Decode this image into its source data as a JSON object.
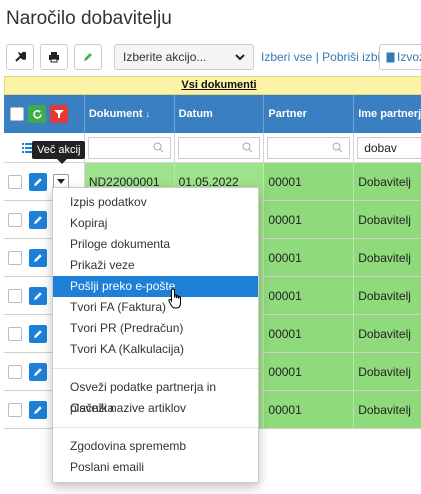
{
  "page": {
    "title": "Naročilo dobavitelju"
  },
  "toolbar": {
    "wrench_icon": "wrench-icon",
    "print_icon": "printer-icon",
    "edit_icon": "pencil-icon",
    "action_select_value": "Izberite akcijo...",
    "select_all_link": "Izberi vse",
    "link_separator": "|",
    "clear_selection_link": "Pobriši izbiro",
    "export_label": "Izvoz"
  },
  "grid": {
    "banner": "Vsi dokumenti",
    "columns": [
      "Dokument",
      "Datum",
      "Partner",
      "Ime partnerja"
    ],
    "filters": {
      "ime_partnerja": "dobav"
    },
    "rows": [
      {
        "dokument": "ND22000001",
        "datum": "01.05.2022",
        "partner": "00001",
        "ime": "Dobavitelj"
      },
      {
        "dokument": "",
        "datum": "",
        "partner": "00001",
        "ime": "Dobavitelj"
      },
      {
        "dokument": "",
        "datum": "",
        "partner": "00001",
        "ime": "Dobavitelj"
      },
      {
        "dokument": "",
        "datum": "",
        "partner": "00001",
        "ime": "Dobavitelj"
      },
      {
        "dokument": "",
        "datum": "",
        "partner": "00001",
        "ime": "Dobavitelj"
      },
      {
        "dokument": "",
        "datum": "",
        "partner": "00001",
        "ime": "Dobavitelj"
      },
      {
        "dokument": "",
        "datum": "",
        "partner": "00001",
        "ime": "Dobavitelj"
      }
    ]
  },
  "tooltip": "Več akcij",
  "menu": {
    "group1": [
      "Izpis podatkov",
      "Kopiraj",
      "Priloge dokumenta",
      "Prikaži veze",
      "Pošlji preko e-pošte",
      "Tvori FA (Faktura)",
      "Tvori PR (Predračun)",
      "Tvori KA (Kalkulacija)"
    ],
    "group2": [
      "Osveži podatke partnerja in plačnika",
      "Osveži nazive artiklov"
    ],
    "group3": [
      "Zgodovina sprememb",
      "Poslani emaili"
    ],
    "highlighted_item": "Pošlji preko e-pošte"
  },
  "colors": {
    "header_blue": "#3a7fc1",
    "row_green": "#9ee28c",
    "banner_yellow": "#fdf3a6",
    "accent": "#1e7fd8"
  }
}
